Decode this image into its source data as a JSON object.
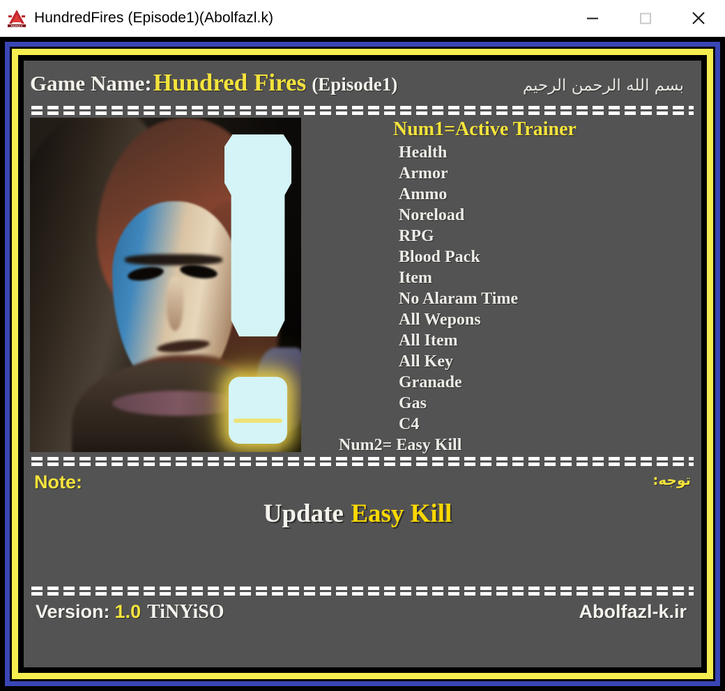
{
  "window": {
    "title": "HundredFires (Episode1)(Abolfazl.k)",
    "app_icon": "abolfazl-a-logo-icon",
    "minimize_label": "minimize-icon",
    "maximize_label": "maximize-icon",
    "close_label": "close-icon"
  },
  "header": {
    "game_name_label": "Game Name:",
    "game_name_value": "Hundred Fires",
    "game_episode": "(Episode1)",
    "bismillah": "بسم الله الرحمن الرحيم"
  },
  "portrait": {
    "alt": "hundred-fires-character-artwork"
  },
  "cheats": {
    "title": "Num1=Active Trainer",
    "items": [
      "Health",
      "Armor",
      "Ammo",
      "Noreload",
      "RPG",
      "Blood Pack",
      "Item",
      "No Alaram Time",
      "All Wepons",
      "All Item",
      "All Key",
      "Granade",
      "Gas",
      "C4"
    ],
    "last_key": "Num2=",
    "last_label": "Easy Kill"
  },
  "note": {
    "label": "Note:",
    "label_fa": "توجه:",
    "update_text": "Update",
    "update_value": "Easy Kill"
  },
  "footer": {
    "version_label": "Version:",
    "version_number": "1.0",
    "release_group": "TiNYiSO",
    "site": "Abolfazl-k.ir"
  },
  "colors": {
    "accent_yellow": "#f4e33c",
    "border_blue": "#3a46b4",
    "border_yellow": "#f6ee4f",
    "panel_bg": "#535353",
    "text_white": "#f2f0ea"
  }
}
